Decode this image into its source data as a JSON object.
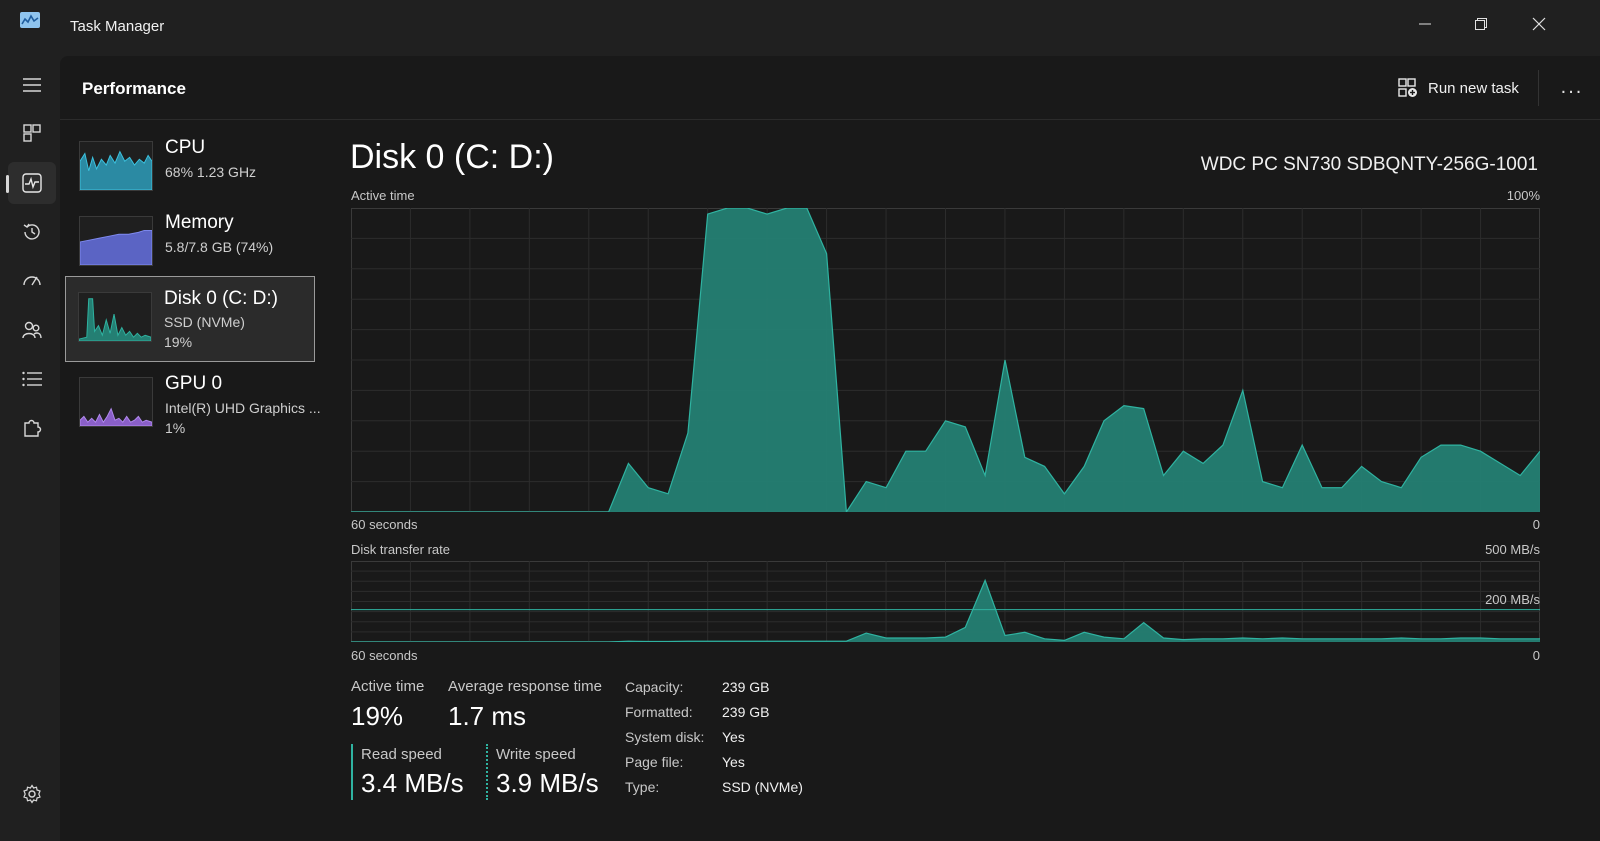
{
  "app": {
    "title": "Task Manager"
  },
  "header": {
    "page_title": "Performance",
    "run_new_task": "Run new task",
    "more": "..."
  },
  "devices": [
    {
      "name": "CPU",
      "sub1": "68%  1.23 GHz",
      "sub2": "",
      "color": "#35a7c2"
    },
    {
      "name": "Memory",
      "sub1": "5.8/7.8 GB (74%)",
      "sub2": "",
      "color": "#6d78d6"
    },
    {
      "name": "Disk 0 (C: D:)",
      "sub1": "SSD (NVMe)",
      "sub2": "19%",
      "color": "#2a9d8f"
    },
    {
      "name": "GPU 0",
      "sub1": "Intel(R) UHD Graphics ...",
      "sub2": "1%",
      "color": "#9b6fd6"
    }
  ],
  "detail": {
    "title": "Disk 0 (C: D:)",
    "model": "WDC PC SN730 SDBQNTY-256G-1001"
  },
  "charts": {
    "active_time": {
      "label": "Active time",
      "max_label": "100%",
      "time_label": "60 seconds",
      "min_label": "0"
    },
    "transfer_rate": {
      "label": "Disk transfer rate",
      "max_label": "500 MB/s",
      "ref_label": "200 MB/s",
      "time_label": "60 seconds",
      "min_label": "0"
    }
  },
  "stats": {
    "active_time_label": "Active time",
    "active_time_value": "19%",
    "avg_response_label": "Average response time",
    "avg_response_value": "1.7 ms",
    "read_label": "Read speed",
    "read_value": "3.4 MB/s",
    "write_label": "Write speed",
    "write_value": "3.9 MB/s"
  },
  "properties": [
    {
      "label": "Capacity:",
      "value": "239 GB"
    },
    {
      "label": "Formatted:",
      "value": "239 GB"
    },
    {
      "label": "System disk:",
      "value": "Yes"
    },
    {
      "label": "Page file:",
      "value": "Yes"
    },
    {
      "label": "Type:",
      "value": "SSD (NVMe)"
    }
  ],
  "colors": {
    "disk_fill": "#247f73",
    "disk_stroke": "#2fb3a1",
    "grid": "#2c2c2c"
  },
  "chart_data": [
    {
      "type": "area",
      "title": "Active time",
      "x": [
        0,
        1,
        2,
        3,
        4,
        5,
        6,
        7,
        8,
        9,
        10,
        11,
        12,
        13,
        14,
        15,
        16,
        17,
        18,
        19,
        20,
        21,
        22,
        23,
        24,
        25,
        26,
        27,
        28,
        29,
        30,
        31,
        32,
        33,
        34,
        35,
        36,
        37,
        38,
        39,
        40,
        41,
        42,
        43,
        44,
        45,
        46,
        47,
        48,
        49,
        50,
        51,
        52,
        53,
        54,
        55,
        56,
        57,
        58,
        59,
        60
      ],
      "y": [
        0,
        0,
        0,
        0,
        0,
        0,
        0,
        0,
        0,
        0,
        0,
        0,
        0,
        0,
        16,
        8,
        6,
        26,
        98,
        100,
        100,
        98,
        100,
        100,
        85,
        0,
        10,
        8,
        20,
        20,
        30,
        28,
        12,
        50,
        18,
        15,
        6,
        15,
        30,
        35,
        34,
        12,
        20,
        16,
        22,
        40,
        10,
        8,
        22,
        8,
        8,
        15,
        10,
        8,
        18,
        22,
        22,
        20,
        16,
        12,
        20
      ],
      "ylim": [
        0,
        100
      ]
    },
    {
      "type": "area",
      "title": "Disk transfer rate",
      "x": [
        0,
        1,
        2,
        3,
        4,
        5,
        6,
        7,
        8,
        9,
        10,
        11,
        12,
        13,
        14,
        15,
        16,
        17,
        18,
        19,
        20,
        21,
        22,
        23,
        24,
        25,
        26,
        27,
        28,
        29,
        30,
        31,
        32,
        33,
        34,
        35,
        36,
        37,
        38,
        39,
        40,
        41,
        42,
        43,
        44,
        45,
        46,
        47,
        48,
        49,
        50,
        51,
        52,
        53,
        54,
        55,
        56,
        57,
        58,
        59,
        60
      ],
      "y": [
        0,
        0,
        0,
        0,
        0,
        0,
        0,
        0,
        0,
        0,
        0,
        0,
        0,
        0,
        5,
        3,
        3,
        5,
        5,
        5,
        5,
        5,
        5,
        5,
        5,
        5,
        55,
        25,
        25,
        25,
        30,
        90,
        380,
        40,
        60,
        20,
        10,
        60,
        30,
        20,
        120,
        25,
        15,
        20,
        20,
        25,
        20,
        25,
        20,
        20,
        20,
        20,
        20,
        25,
        20,
        20,
        25,
        25,
        20,
        20,
        20
      ],
      "ylim": [
        0,
        500
      ],
      "reference_line": 200
    }
  ]
}
